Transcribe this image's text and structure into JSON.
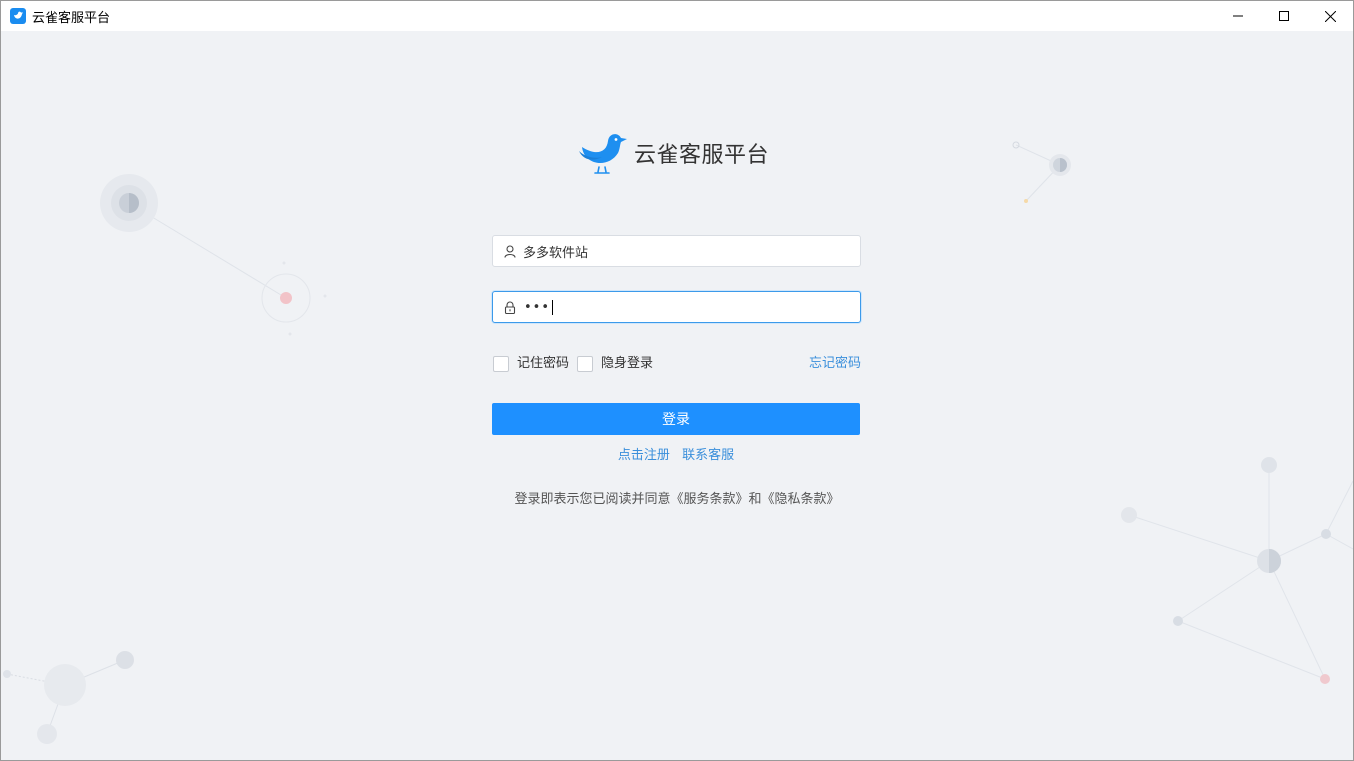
{
  "window": {
    "title": "云雀客服平台",
    "controls": [
      "minimize-icon",
      "maximize-icon",
      "close-icon"
    ]
  },
  "brand": {
    "name": "云雀客服平台",
    "accent_color": "#1e90ff",
    "link_color": "#3a8fdb"
  },
  "form": {
    "username": {
      "value": "多多软件站",
      "icon": "user-icon"
    },
    "password": {
      "masked_value": "•••",
      "icon": "lock-icon"
    },
    "remember_password_label": "记住密码",
    "invisible_login_label": "隐身登录",
    "forgot_password_label": "忘记密码",
    "login_button_label": "登录"
  },
  "links": {
    "register_label": "点击注册",
    "contact_support_label": "联系客服"
  },
  "agreement_text": "登录即表示您已阅读并同意《服务条款》和《隐私条款》"
}
